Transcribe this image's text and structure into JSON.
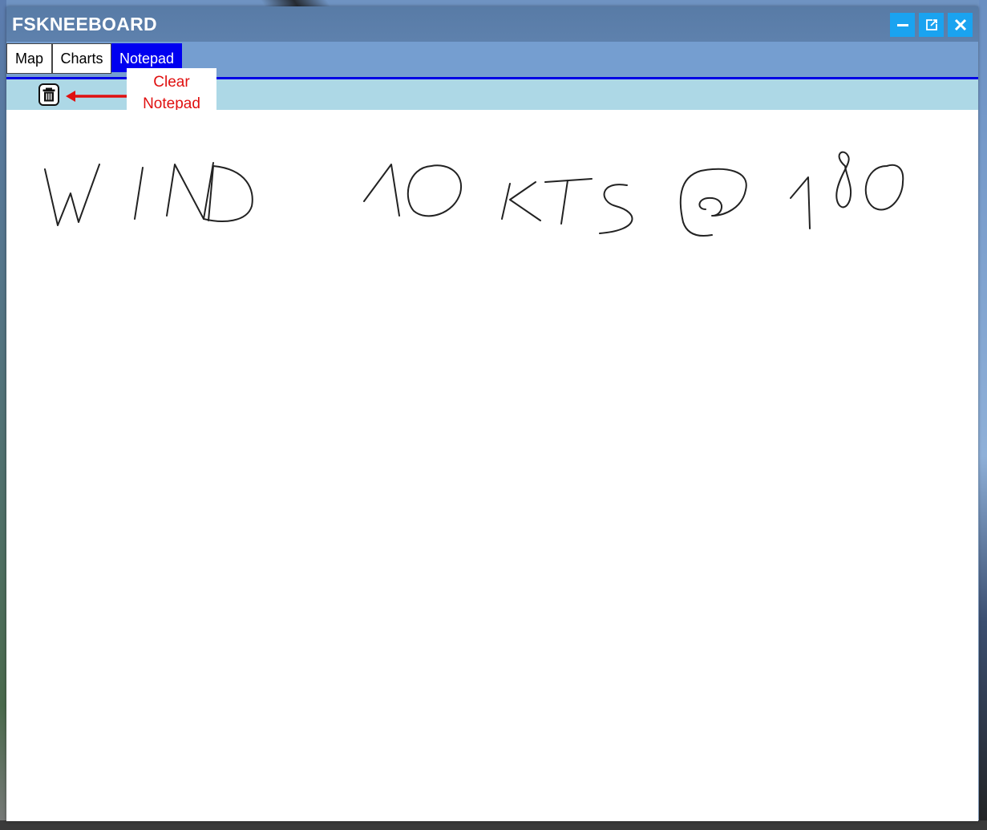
{
  "window": {
    "title": "FSKNEEBOARD",
    "controls": {
      "minimize_icon": "minimize-icon",
      "popout_icon": "popout-icon",
      "close_icon": "close-icon"
    }
  },
  "tabs": [
    {
      "label": "Map",
      "active": false
    },
    {
      "label": "Charts",
      "active": false
    },
    {
      "label": "Notepad",
      "active": true
    }
  ],
  "toolbar": {
    "clear_icon": "trash-icon"
  },
  "annotation": {
    "line1": "Clear",
    "line2": "Notepad",
    "color": "#e01010"
  },
  "notepad": {
    "handwritten_text": "WIND 10 KTS @ 180"
  },
  "colors": {
    "titlebar": "#5e81ad",
    "active_tab": "#0000f0",
    "toolbar": "#add8e6",
    "window_buttons": "#1aa3f0"
  }
}
